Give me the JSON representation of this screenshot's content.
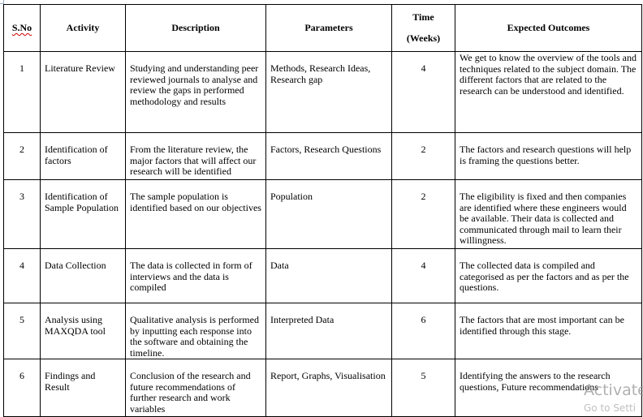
{
  "table": {
    "headers": {
      "sno": "S.No",
      "activity": "Activity",
      "description": "Description",
      "parameters": "Parameters",
      "time_line1": "Time",
      "time_line2": "(Weeks)",
      "outcomes": "Expected Outcomes"
    },
    "rows": [
      {
        "sno": "1",
        "activity": "Literature Review",
        "description": "Studying and understanding peer reviewed journals to analyse and review the gaps in performed methodology and results",
        "parameters": "Methods, Research Ideas, Research gap",
        "time": "4",
        "outcomes": "We get to know the overview of the tools and techniques related to the subject domain. The different factors that are related to the research can be understood and identified."
      },
      {
        "sno": "2",
        "activity": "Identification of factors",
        "description": "From the literature review, the major factors that will affect our research will be identified",
        "parameters": "Factors, Research Questions",
        "time": "2",
        "outcomes": "The factors and research questions will help is framing the questions better."
      },
      {
        "sno": "3",
        "activity": "Identification of Sample Population",
        "description": "The sample population is identified based on our objectives",
        "parameters": "Population",
        "time": "2",
        "outcomes": "The eligibility is fixed and then companies are identified where these engineers would be available. Their data is collected and communicated through mail to learn their willingness."
      },
      {
        "sno": "4",
        "activity": "Data Collection",
        "description": "The data is collected in form of interviews and the data is compiled",
        "parameters": "Data",
        "time": "4",
        "outcomes": "The collected data is compiled and categorised as per the factors and as per the questions."
      },
      {
        "sno": "5",
        "activity": "Analysis using MAXQDA tool",
        "description": "Qualitative analysis is performed by inputting each response into the software and obtaining the timeline.",
        "parameters": "Interpreted Data",
        "time": "6",
        "outcomes": "The factors that are most important can be identified through this stage."
      },
      {
        "sno": "6",
        "activity": "Findings and Result",
        "description": "Conclusion of the research and future recommendations of further research and work variables",
        "parameters": "Report, Graphs, Visualisation",
        "time": "5",
        "outcomes": "Identifying the answers to the research questions, Future recommendations"
      }
    ]
  },
  "watermark": {
    "line1": "Activate",
    "line2": "Go to Setti"
  }
}
